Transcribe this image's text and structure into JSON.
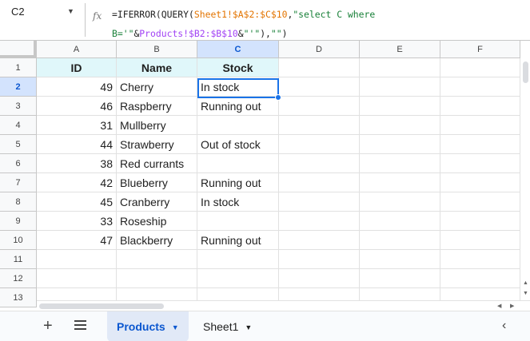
{
  "formula_bar": {
    "name_box": "C2",
    "fx_label": "fx",
    "formula": {
      "part1": "=IFERROR(QUERY(",
      "ref1": "Sheet1!$A$2:$C$10",
      "part2": ",",
      "str1": "\"select C where B='\"",
      "part3": "&",
      "ref2": "Products!$B2:$B$10",
      "part4": "&",
      "str2": "\"'\"",
      "part5": "),",
      "str3": "\"\"",
      "part6": ")"
    }
  },
  "columns": [
    "A",
    "B",
    "C",
    "D",
    "E",
    "F"
  ],
  "rows": [
    "1",
    "2",
    "3",
    "4",
    "5",
    "6",
    "7",
    "8",
    "9",
    "10",
    "11",
    "12",
    "13"
  ],
  "table": {
    "headers": [
      "ID",
      "Name",
      "Stock"
    ],
    "data": [
      [
        "49",
        "Cherry",
        "In stock"
      ],
      [
        "46",
        "Raspberry",
        "Running out"
      ],
      [
        "31",
        "Mullberry",
        ""
      ],
      [
        "44",
        "Strawberry",
        "Out of stock"
      ],
      [
        "38",
        "Red currants",
        ""
      ],
      [
        "42",
        "Blueberry",
        "Running out"
      ],
      [
        "45",
        "Cranberry",
        "In stock"
      ],
      [
        "33",
        "Roseship",
        ""
      ],
      [
        "47",
        "Blackberry",
        "Running out"
      ]
    ]
  },
  "selected_cell": "C2",
  "sheet_tabs": [
    {
      "label": "Products",
      "active": true
    },
    {
      "label": "Sheet1",
      "active": false
    }
  ],
  "icons": {
    "add_sheet": "plus-icon",
    "all_sheets": "menu-icon",
    "collapse": "chevron-left-icon",
    "dropdown": "caret-down-icon"
  },
  "colors": {
    "header_fill": "#e0f7fa",
    "selection": "#1a73e8",
    "active_tab": "#e1e9f7"
  }
}
